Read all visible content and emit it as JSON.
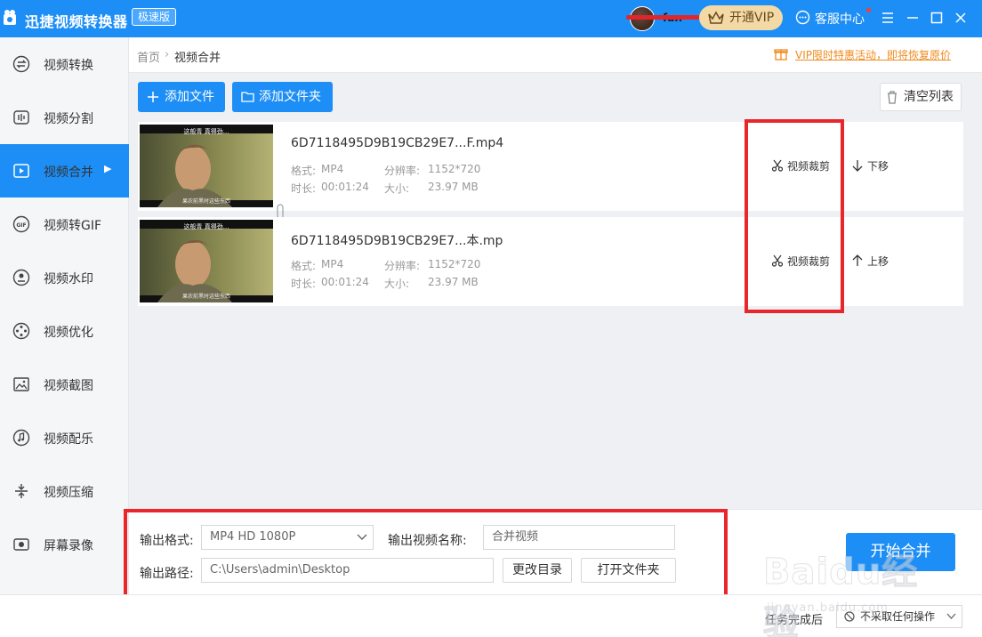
{
  "app": {
    "title": "迅捷视频转换器",
    "edition": "极速版",
    "username": "fan",
    "vip_label": "开通VIP",
    "service_label": "客服中心"
  },
  "sidebar": {
    "items": [
      {
        "label": "视频转换",
        "icon": "convert-icon"
      },
      {
        "label": "视频分割",
        "icon": "split-icon"
      },
      {
        "label": "视频合并",
        "icon": "merge-icon",
        "active": true
      },
      {
        "label": "视频转GIF",
        "icon": "gif-icon"
      },
      {
        "label": "视频水印",
        "icon": "watermark-icon"
      },
      {
        "label": "视频优化",
        "icon": "optimize-icon"
      },
      {
        "label": "视频截图",
        "icon": "screenshot-icon"
      },
      {
        "label": "视频配乐",
        "icon": "music-icon"
      },
      {
        "label": "视频压缩",
        "icon": "compress-icon"
      },
      {
        "label": "屏幕录像",
        "icon": "record-icon"
      }
    ]
  },
  "breadcrumb": {
    "home": "首页",
    "current": "视频合并"
  },
  "promo_text": "VIP限时特惠活动，即将恢复原价",
  "toolbar": {
    "add_file": "添加文件",
    "add_folder": "添加文件夹",
    "clear_list": "清空列表"
  },
  "files": [
    {
      "name": "6D7118495D9B19CB29E7...F.mp4",
      "format_label": "格式:",
      "format": "MP4",
      "res_label": "分辨率:",
      "resolution": "1152*720",
      "duration_label": "时长:",
      "duration": "00:01:24",
      "size_label": "大小:",
      "size": "23.97 MB",
      "crop_label": "视频裁剪",
      "move_label": "下移",
      "thumb_caption": "这般青 真得劲...",
      "thumb_footer": "果农前黑时这些东西"
    },
    {
      "name": "6D7118495D9B19CB29E7...本.mp",
      "format_label": "格式:",
      "format": "MP4",
      "res_label": "分辨率:",
      "resolution": "1152*720",
      "duration_label": "时长:",
      "duration": "00:01:24",
      "size_label": "大小:",
      "size": "23.97 MB",
      "crop_label": "视频裁剪",
      "move_label": "上移",
      "thumb_caption": "这般青 真得劲...",
      "thumb_footer": "果农前黑时这些东西"
    }
  ],
  "output": {
    "format_label": "输出格式:",
    "format_value": "MP4  HD 1080P",
    "name_label": "输出视频名称:",
    "name_value": "合并视频",
    "path_label": "输出路径:",
    "path_value": "C:\\Users\\admin\\Desktop",
    "change_dir": "更改目录",
    "open_folder": "打开文件夹",
    "start": "开始合并"
  },
  "footer": {
    "after_label": "任务完成后",
    "after_value": "不采取任何操作"
  },
  "watermark": {
    "text": "Baidu经验",
    "sub": "jingyan.baidu.com"
  },
  "colors": {
    "primary": "#1d8ef5",
    "highlight": "#e8262c",
    "promo": "#f08a1c",
    "vip_bg": "#f3d9a6"
  }
}
